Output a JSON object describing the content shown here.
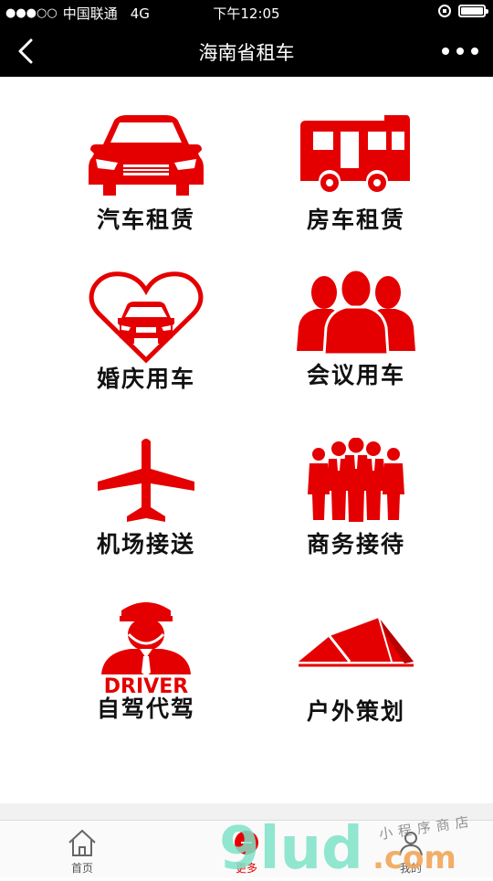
{
  "status_bar": {
    "signal_dots": "●●●○○",
    "carrier": "中国联通",
    "network": "4G",
    "time": "下午12:05"
  },
  "nav": {
    "title": "海南省租车"
  },
  "tiles": [
    {
      "label": "汽车租赁",
      "icon": "car-icon"
    },
    {
      "label": "房车租赁",
      "icon": "rv-icon"
    },
    {
      "label": "婚庆用车",
      "icon": "heart-car-icon"
    },
    {
      "label": "会议用车",
      "icon": "people-icon"
    },
    {
      "label": "机场接送",
      "icon": "airplane-icon"
    },
    {
      "label": "商务接待",
      "icon": "business-people-icon"
    },
    {
      "label": "自驾代驾",
      "icon": "driver-icon",
      "badge": "DRIVER"
    },
    {
      "label": "户外策划",
      "icon": "tent-icon"
    }
  ],
  "tab_bar": {
    "items": [
      {
        "label": "首页",
        "icon": "home-icon"
      },
      {
        "label": "更多",
        "icon": "more-icon"
      },
      {
        "label": "我的",
        "icon": "user-icon"
      }
    ]
  },
  "watermark": {
    "brand": "9lud",
    "suffix": ".com",
    "tagline": "小程序商店"
  },
  "colors": {
    "accent": "#e40000",
    "nav_bg": "#000000"
  }
}
